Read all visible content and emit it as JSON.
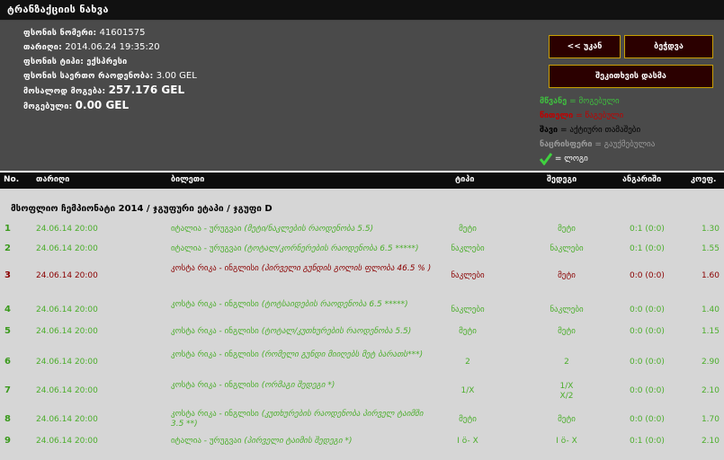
{
  "title": "ტრანზაქციის ნახვა",
  "info": {
    "slip_number_label": "ფსონის ნომერი:",
    "slip_number": "41601575",
    "date_label": "თარიღი:",
    "date": "2014.06.24 19:35:20",
    "type_label": "ფსონის ტიპი:",
    "type": "ექსპრესი",
    "total_coef_label": "ფსონის საერთო რაოდენობა:",
    "total_coef": "3.00 GEL",
    "possible_win_label": "მოსალოდ მოგება:",
    "possible_win": "257.176 GEL",
    "win_label": "მოგებული:",
    "win": "0.00 GEL"
  },
  "buttons": {
    "back": "<< უკან",
    "print": "ბეჭდვა",
    "check": "შეკითხვის დასმა"
  },
  "legend": {
    "green_key": "მწვანე",
    "green_val": "= მოგებული",
    "red_key": "წითელი",
    "red_val": "= წაგებული",
    "black_key": "შავი",
    "black_val": "= აქტიური თამაშები",
    "gray_key": "ნაცრისფერი",
    "gray_val": "= გაუქმებულია",
    "check_val": "= ლოგი"
  },
  "colors": {
    "win": "#4cae2c",
    "loss": "#8a0000",
    "accent": "#c8a000"
  },
  "columns": {
    "no": "No.",
    "date": "თარიღი",
    "bet": "ბილეთი",
    "type": "ტიპი",
    "result": "შედეგი",
    "score": "ანგარიში",
    "coef": "კოეფ."
  },
  "section_title": "მსოფლიო ჩემპიონატი 2014 / ჯგუფური ეტაპი / ჯგუფი D",
  "rows": [
    {
      "no": "1",
      "date": "24.06.14 20:00",
      "teams": "იტალია - ურუგვაი",
      "market": "(მეტი/ნაკლების რაოდენობა 5.5)",
      "type": "მეტი",
      "result": "მეტი",
      "score": "0:1 (0:0)",
      "coef": "1.30"
    },
    {
      "no": "2",
      "date": "24.06.14 20:00",
      "teams": "იტალია - ურუგვაი",
      "market": "(ტოტალ/კორნერების რაოდენობა 6.5 *****)",
      "type": "ნაკლები",
      "result": "ნაკლები",
      "score": "0:1 (0:0)",
      "coef": "1.55"
    },
    {
      "no": "3",
      "date": "24.06.14 20:00",
      "teams": "კოსტა რიკა - ინგლისი",
      "market": "(პირველი გუნდის გოლის ფლობა 46.5 % )",
      "type": "ნაკლები",
      "result": "მეტი",
      "score": "0:0 (0:0)",
      "coef": "1.60"
    },
    {
      "no": "4",
      "date": "24.06.14 20:00",
      "teams": "კოსტა რიკა - ინგლისი",
      "market": "(ტოტსაიდების რაოდენობა 6.5 *****)",
      "type": "ნაკლები",
      "result": "ნაკლები",
      "score": "0:0 (0:0)",
      "coef": "1.40"
    },
    {
      "no": "5",
      "date": "24.06.14 20:00",
      "teams": "კოსტა რიკა - ინგლისი",
      "market": "(ტოტალ/კუთხურების რაოდენობა 5.5)",
      "type": "მეტი",
      "result": "მეტი",
      "score": "0:0 (0:0)",
      "coef": "1.15"
    },
    {
      "no": "6",
      "date": "24.06.14 20:00",
      "teams": "კოსტა რიკა - ინგლისი",
      "market": "(რომელი გუნდი მიიღებს მეტ ბარათს***)",
      "type": "2",
      "result": "2",
      "score": "0:0 (0:0)",
      "coef": "2.90"
    },
    {
      "no": "7",
      "date": "24.06.14 20:00",
      "teams": "კოსტა რიკა - ინგლისი",
      "market": "(ორმაგი შედეგი *)",
      "type": "1/X",
      "result": "1/X\nX/2",
      "score": "0:0 (0:0)",
      "coef": "2.10"
    },
    {
      "no": "8",
      "date": "24.06.14 20:00",
      "teams": "კოსტა რიკა - ინგლისი",
      "market": "(კუთხურების რაოდენობა პირველ ტაიმში 3.5 **)",
      "type": "მეტი",
      "result": "მეტი",
      "score": "0:0 (0:0)",
      "coef": "1.70"
    },
    {
      "no": "9",
      "date": "24.06.14 20:00",
      "teams": "იტალია - ურუგვაი",
      "market": "(პირველი ტაიმის შედეგი *)",
      "type": "I ö- X",
      "result": "I ö- X",
      "score": "0:1 (0:0)",
      "coef": "2.10"
    }
  ]
}
